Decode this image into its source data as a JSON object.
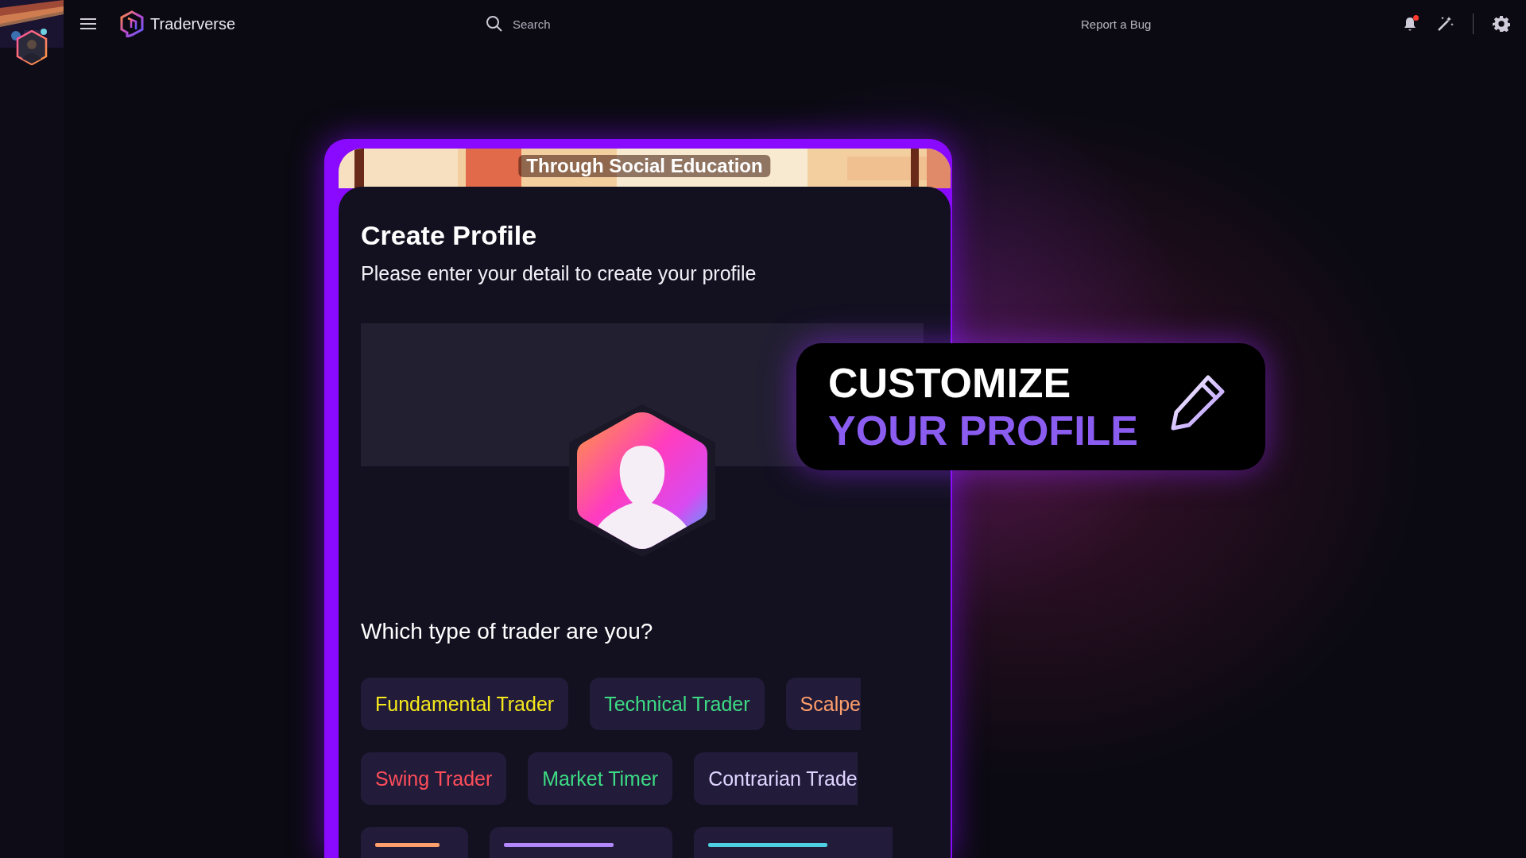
{
  "topbar": {
    "brand": "Traderverse",
    "search": {
      "placeholder": "Search"
    },
    "report_link": "Report a Bug",
    "notification_dot": true
  },
  "banner": {
    "caption": "Through Social Education"
  },
  "profile_form": {
    "title": "Create Profile",
    "subtitle": "Please enter your detail to create your profile",
    "question": "Which type of trader are you?",
    "trader_types": [
      [
        {
          "label": "Fundamental Trader",
          "color": "#f5e81c"
        },
        {
          "label": "Technical Trader",
          "color": "#3ddc84"
        },
        {
          "label": "Scalpe",
          "color": "#ff9f6b"
        }
      ],
      [
        {
          "label": "Swing Trader",
          "color": "#ff4d5a"
        },
        {
          "label": "Market Timer",
          "color": "#3ddc84"
        },
        {
          "label": "Contrarian Trade",
          "color": "#e0d4ff"
        }
      ],
      [
        {
          "color": "#ff9f6b"
        },
        {
          "color": "#b388ff"
        },
        {
          "color": "#4dd0e1"
        }
      ]
    ]
  },
  "promo": {
    "line_1": "CUSTOMIZE",
    "line_2": "YOUR PROFILE"
  }
}
